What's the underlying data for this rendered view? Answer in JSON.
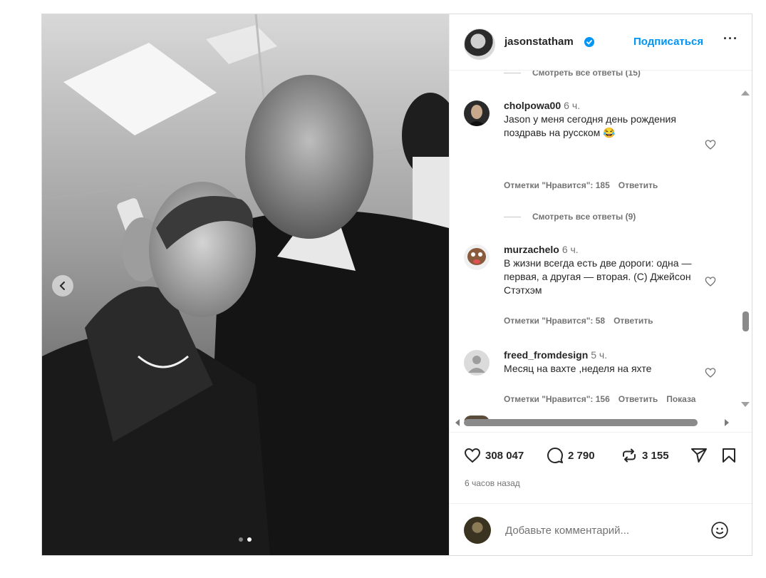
{
  "post": {
    "username": "jasonstatham",
    "follow_label": "Подписаться",
    "more_label": "···",
    "image_dots": 2,
    "active_dot": 2
  },
  "comments": [
    {
      "type": "view_replies",
      "label": "Смотреть все ответы (15)"
    },
    {
      "type": "comment",
      "username": "cholpowa00",
      "time": "6 ч.",
      "text": "Jason у меня сегодня день рождения поздравь на русском 😂",
      "likes": "Отметки \"Нравится\": 185",
      "reply": "Ответить"
    },
    {
      "type": "view_replies",
      "label": "Смотреть все ответы (9)"
    },
    {
      "type": "comment",
      "username": "murzachelo",
      "time": "6 ч.",
      "text": "В жизни всегда есть две дороги: одна — первая, а другая — вторая. (С) Джейсон Стэтхэм",
      "likes": "Отметки \"Нравится\": 58",
      "reply": "Ответить"
    },
    {
      "type": "comment",
      "username": "freed_fromdesign",
      "time": "5 ч.",
      "text": "Месяц на вахте ,неделя на яхте",
      "likes": "Отметки \"Нравится\": 156",
      "reply": "Ответить",
      "extra": "Показа"
    }
  ],
  "actions": {
    "likes_count": "308 047",
    "comments_count": "2 790",
    "reposts_count": "3 155",
    "time_ago": "6 часов назад"
  },
  "add_comment": {
    "placeholder": "Добавьте комментарий..."
  },
  "icons": {
    "like": "heart-icon",
    "comment": "comment-bubble-icon",
    "repost": "repost-icon",
    "share": "send-icon",
    "save": "bookmark-icon",
    "emoji": "smiley-icon",
    "verified": "verified-badge-icon",
    "prev": "chevron-left-icon"
  },
  "colors": {
    "link_blue": "#0095f6",
    "verified_blue": "#0095f6",
    "text_primary": "#262626",
    "text_secondary": "#737373"
  }
}
